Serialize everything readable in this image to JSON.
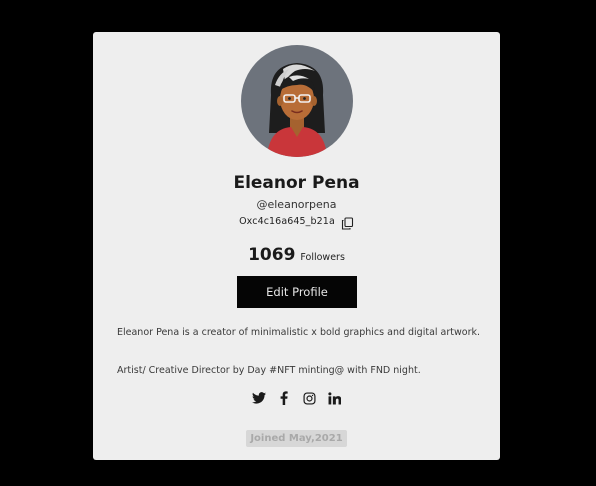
{
  "profile": {
    "name": "Eleanor Pena",
    "handle": "@eleanorpena",
    "wallet": "Oxc4c16a645_b21a",
    "followers_count": "1069",
    "followers_label": "Followers",
    "edit_button_label": "Edit Profile",
    "bio_line_1": "Eleanor Pena is a creator of minimalistic x bold graphics and digital artwork.",
    "bio_line_2": "Artist/ Creative Director by Day #NFT minting@ with FND night.",
    "joined": "Joined May,2021"
  },
  "icons": {
    "copy": "copy-icon",
    "socials": [
      "twitter-icon",
      "facebook-icon",
      "instagram-icon",
      "linkedin-icon"
    ]
  },
  "colors": {
    "page_background": "#000000",
    "card_background": "#eeeeee",
    "button_background": "#050505",
    "button_text": "#e6e6e6",
    "avatar_background": "#6d737c",
    "badge_background": "#d7d7d7",
    "badge_text": "#a9a9a9"
  }
}
